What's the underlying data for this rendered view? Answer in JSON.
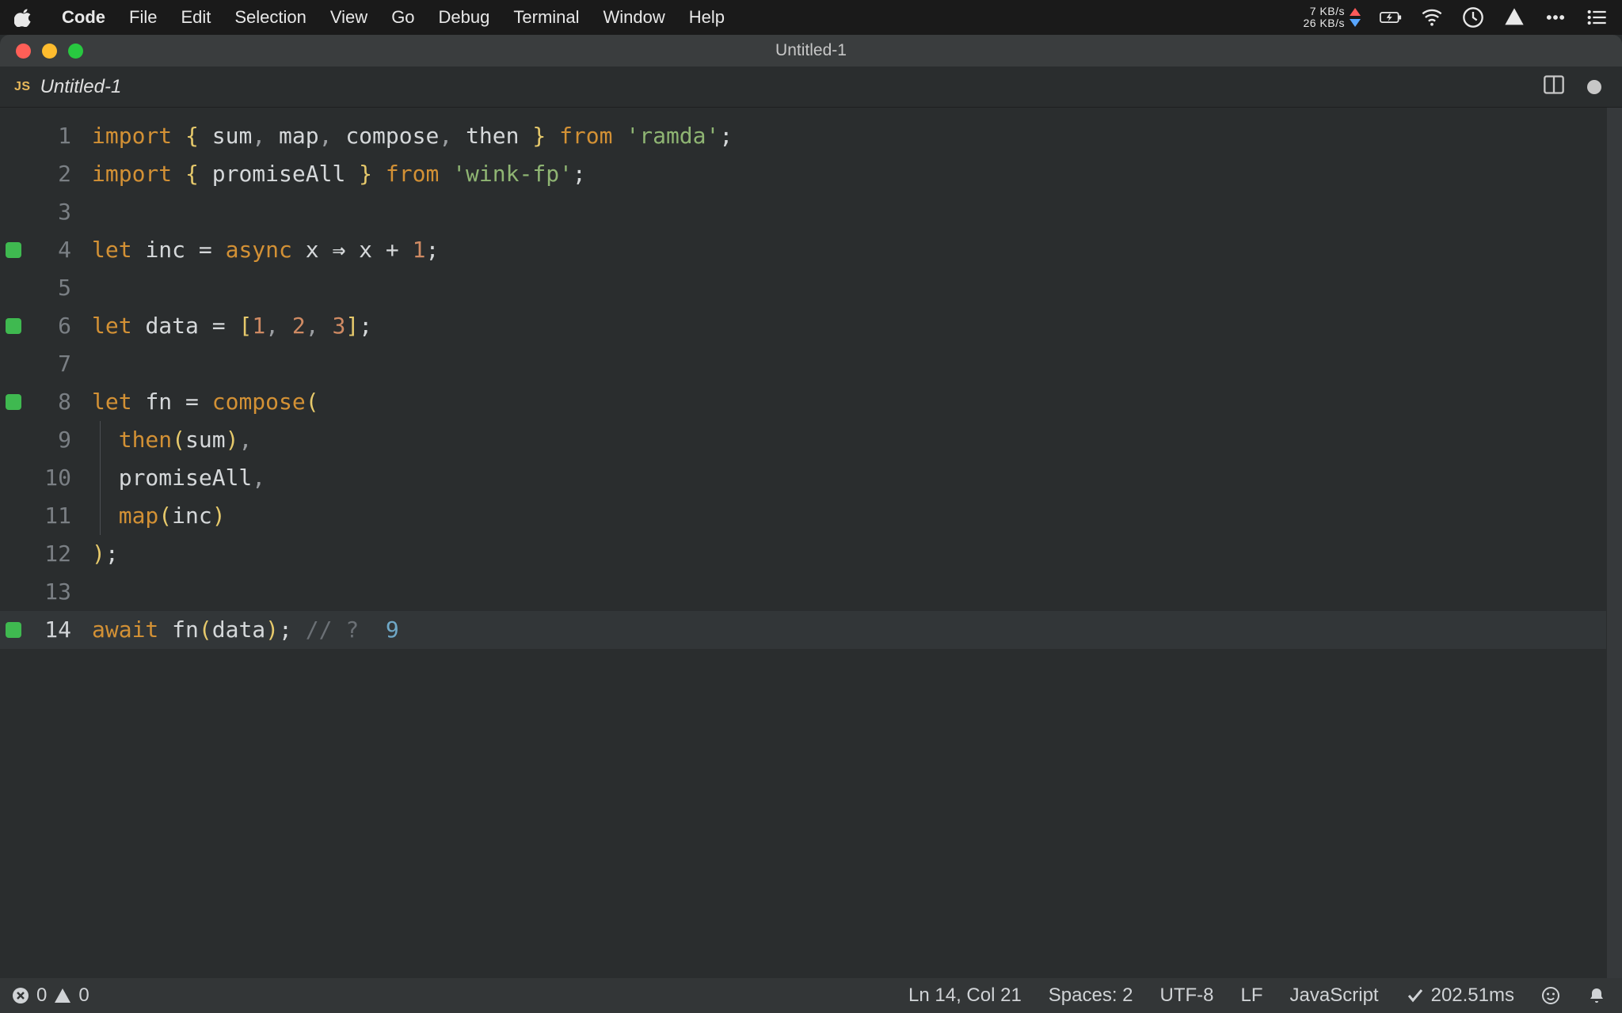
{
  "mac_menu": {
    "app": "Code",
    "items": [
      "File",
      "Edit",
      "Selection",
      "View",
      "Go",
      "Debug",
      "Terminal",
      "Window",
      "Help"
    ]
  },
  "mac_status": {
    "net_up": "7 KB/s",
    "net_down": "26 KB/s"
  },
  "window_title": "Untitled-1",
  "tab": {
    "lang_badge": "JS",
    "filename": "Untitled-1"
  },
  "code_lines": [
    {
      "n": 1,
      "marker": false,
      "tokens": [
        {
          "t": "import",
          "c": "tok-kw"
        },
        {
          "t": " "
        },
        {
          "t": "{",
          "c": "tok-brace"
        },
        {
          "t": " "
        },
        {
          "t": "sum",
          "c": "tok-ident"
        },
        {
          "t": ",",
          "c": "tok-comma"
        },
        {
          "t": " "
        },
        {
          "t": "map",
          "c": "tok-ident"
        },
        {
          "t": ",",
          "c": "tok-comma"
        },
        {
          "t": " "
        },
        {
          "t": "compose",
          "c": "tok-ident"
        },
        {
          "t": ",",
          "c": "tok-comma"
        },
        {
          "t": " "
        },
        {
          "t": "then",
          "c": "tok-ident"
        },
        {
          "t": " "
        },
        {
          "t": "}",
          "c": "tok-brace"
        },
        {
          "t": " "
        },
        {
          "t": "from",
          "c": "tok-kw"
        },
        {
          "t": " "
        },
        {
          "t": "'ramda'",
          "c": "tok-str"
        },
        {
          "t": ";",
          "c": "tok-punct"
        }
      ]
    },
    {
      "n": 2,
      "marker": false,
      "tokens": [
        {
          "t": "import",
          "c": "tok-kw"
        },
        {
          "t": " "
        },
        {
          "t": "{",
          "c": "tok-brace"
        },
        {
          "t": " "
        },
        {
          "t": "promiseAll",
          "c": "tok-ident"
        },
        {
          "t": " "
        },
        {
          "t": "}",
          "c": "tok-brace"
        },
        {
          "t": " "
        },
        {
          "t": "from",
          "c": "tok-kw"
        },
        {
          "t": " "
        },
        {
          "t": "'wink-fp'",
          "c": "tok-str"
        },
        {
          "t": ";",
          "c": "tok-punct"
        }
      ]
    },
    {
      "n": 3,
      "marker": false,
      "tokens": []
    },
    {
      "n": 4,
      "marker": true,
      "tokens": [
        {
          "t": "let",
          "c": "tok-kw"
        },
        {
          "t": " "
        },
        {
          "t": "inc",
          "c": "tok-ident"
        },
        {
          "t": " = "
        },
        {
          "t": "async",
          "c": "tok-kw"
        },
        {
          "t": " x "
        },
        {
          "t": "⇒",
          "c": "tok-arrow"
        },
        {
          "t": " x + "
        },
        {
          "t": "1",
          "c": "tok-num"
        },
        {
          "t": ";",
          "c": "tok-punct"
        }
      ]
    },
    {
      "n": 5,
      "marker": false,
      "tokens": []
    },
    {
      "n": 6,
      "marker": true,
      "tokens": [
        {
          "t": "let",
          "c": "tok-kw"
        },
        {
          "t": " "
        },
        {
          "t": "data",
          "c": "tok-ident"
        },
        {
          "t": " = "
        },
        {
          "t": "[",
          "c": "tok-brace"
        },
        {
          "t": "1",
          "c": "tok-num"
        },
        {
          "t": ",",
          "c": "tok-comma"
        },
        {
          "t": " "
        },
        {
          "t": "2",
          "c": "tok-num"
        },
        {
          "t": ",",
          "c": "tok-comma"
        },
        {
          "t": " "
        },
        {
          "t": "3",
          "c": "tok-num"
        },
        {
          "t": "]",
          "c": "tok-brace"
        },
        {
          "t": ";",
          "c": "tok-punct"
        }
      ]
    },
    {
      "n": 7,
      "marker": false,
      "tokens": []
    },
    {
      "n": 8,
      "marker": true,
      "tokens": [
        {
          "t": "let",
          "c": "tok-kw"
        },
        {
          "t": " "
        },
        {
          "t": "fn",
          "c": "tok-ident"
        },
        {
          "t": " = "
        },
        {
          "t": "compose",
          "c": "tok-func"
        },
        {
          "t": "(",
          "c": "tok-brace"
        }
      ]
    },
    {
      "n": 9,
      "marker": false,
      "indent_guide": true,
      "tokens": [
        {
          "t": "  "
        },
        {
          "t": "then",
          "c": "tok-func"
        },
        {
          "t": "(",
          "c": "tok-brace"
        },
        {
          "t": "sum",
          "c": "tok-ident"
        },
        {
          "t": ")",
          "c": "tok-brace"
        },
        {
          "t": ",",
          "c": "tok-comma"
        }
      ]
    },
    {
      "n": 10,
      "marker": false,
      "indent_guide": true,
      "tokens": [
        {
          "t": "  "
        },
        {
          "t": "promiseAll",
          "c": "tok-ident"
        },
        {
          "t": ",",
          "c": "tok-comma"
        }
      ]
    },
    {
      "n": 11,
      "marker": false,
      "indent_guide": true,
      "tokens": [
        {
          "t": "  "
        },
        {
          "t": "map",
          "c": "tok-func"
        },
        {
          "t": "(",
          "c": "tok-brace"
        },
        {
          "t": "inc",
          "c": "tok-ident"
        },
        {
          "t": ")",
          "c": "tok-brace"
        }
      ]
    },
    {
      "n": 12,
      "marker": false,
      "tokens": [
        {
          "t": ")",
          "c": "tok-brace"
        },
        {
          "t": ";",
          "c": "tok-punct"
        }
      ]
    },
    {
      "n": 13,
      "marker": false,
      "tokens": []
    },
    {
      "n": 14,
      "marker": true,
      "current": true,
      "tokens": [
        {
          "t": "await",
          "c": "tok-kw"
        },
        {
          "t": " "
        },
        {
          "t": "fn",
          "c": "tok-ident"
        },
        {
          "t": "(",
          "c": "tok-brace"
        },
        {
          "t": "data",
          "c": "tok-ident"
        },
        {
          "t": ")",
          "c": "tok-brace"
        },
        {
          "t": ";",
          "c": "tok-punct"
        },
        {
          "t": " "
        },
        {
          "t": "// ?  ",
          "c": "tok-comment"
        },
        {
          "t": "9",
          "c": "tok-result"
        }
      ]
    }
  ],
  "statusbar": {
    "errors": "0",
    "warnings": "0",
    "position": "Ln 14, Col 21",
    "spaces": "Spaces: 2",
    "encoding": "UTF-8",
    "eol": "LF",
    "language": "JavaScript",
    "timing": "202.51ms"
  }
}
